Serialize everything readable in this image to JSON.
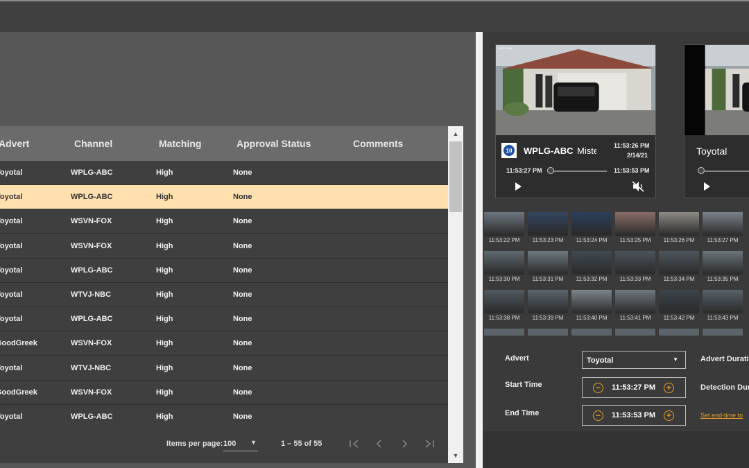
{
  "table": {
    "columns": [
      "Advert",
      "Channel",
      "Matching",
      "Approval Status",
      "Comments"
    ],
    "rows": [
      {
        "advert": "Toyotal",
        "channel": "WPLG-ABC",
        "matching": "High",
        "status": "None",
        "comments": ""
      },
      {
        "advert": "Toyotal",
        "channel": "WPLG-ABC",
        "matching": "High",
        "status": "None",
        "comments": ""
      },
      {
        "advert": "Toyotal",
        "channel": "WSVN-FOX",
        "matching": "High",
        "status": "None",
        "comments": ""
      },
      {
        "advert": "Toyotal",
        "channel": "WSVN-FOX",
        "matching": "High",
        "status": "None",
        "comments": ""
      },
      {
        "advert": "Toyotal",
        "channel": "WPLG-ABC",
        "matching": "High",
        "status": "None",
        "comments": ""
      },
      {
        "advert": "Toyotal",
        "channel": "WTVJ-NBC",
        "matching": "High",
        "status": "None",
        "comments": ""
      },
      {
        "advert": "Toyotal",
        "channel": "WPLG-ABC",
        "matching": "High",
        "status": "None",
        "comments": ""
      },
      {
        "advert": "GoodGreek",
        "channel": "WSVN-FOX",
        "matching": "High",
        "status": "None",
        "comments": ""
      },
      {
        "advert": "Toyotal",
        "channel": "WTVJ-NBC",
        "matching": "High",
        "status": "None",
        "comments": ""
      },
      {
        "advert": "GoodGreek",
        "channel": "WSVN-FOX",
        "matching": "High",
        "status": "None",
        "comments": ""
      },
      {
        "advert": "Toyotal",
        "channel": "WPLG-ABC",
        "matching": "High",
        "status": "None",
        "comments": ""
      }
    ],
    "selected_row": 1
  },
  "paginator": {
    "items_per_page_label": "Items per page:",
    "items_per_page_value": "100",
    "range": "1 – 55 of 55",
    "first_icon": "first-page-icon",
    "prev_icon": "chevron-left-icon",
    "next_icon": "chevron-right-icon",
    "last_icon": "last-page-icon"
  },
  "player1": {
    "channel": "WPLG-ABC",
    "program": "Miste",
    "time": "11:53:26 PM",
    "date": "2/14/21",
    "start": "11:53:27 PM",
    "end": "11:53:53 PM",
    "logo": "10"
  },
  "player2": {
    "title": "Toyotal"
  },
  "filmstrip": {
    "rows": [
      [
        "11:53:22 PM",
        "11:53:23 PM",
        "11:53:24 PM",
        "11:53:25 PM",
        "11:53:26 PM",
        "11:53:27 PM"
      ],
      [
        "11:53:30 PM",
        "11:53:31 PM",
        "11:53:32 PM",
        "11:53:33 PM",
        "11:53:34 PM",
        "11:53:35 PM"
      ],
      [
        "11:53:38 PM",
        "11:53:39 PM",
        "11:53:40 PM",
        "11:53:41 PM",
        "11:53:42 PM",
        "11:53:43 PM"
      ]
    ]
  },
  "form": {
    "advert_label": "Advert",
    "advert_value": "Toyotal",
    "start_label": "Start Time",
    "start_value": "11:53:27 PM",
    "end_label": "End Time",
    "end_value": "11:53:53 PM",
    "advert_duration_label": "Advert Duratio",
    "detection_duration_label": "Detection Dur",
    "set_end_link": "Set end-time to"
  },
  "colors": {
    "accent": "#f0a020",
    "selected_row": "#ffe0ae"
  }
}
